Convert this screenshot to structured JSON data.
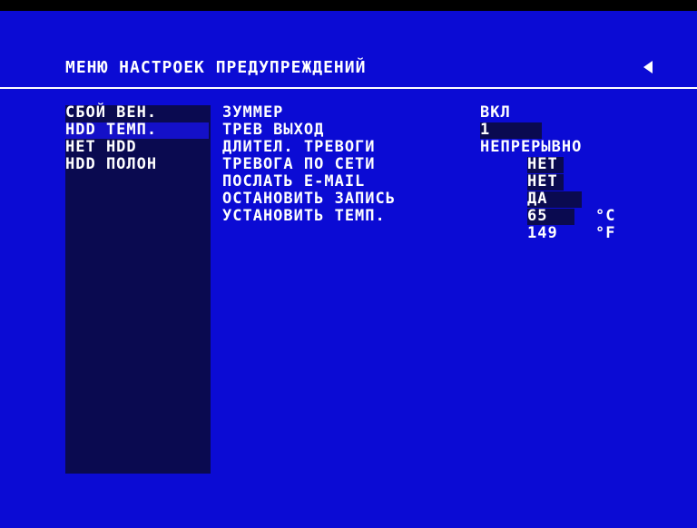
{
  "menu": {
    "title": "МЕНЮ НАСТРОЕК ПРЕДУПРЕЖДЕНИЙ",
    "back_icon": "left-triangle-arrow"
  },
  "sidebar": {
    "items": [
      {
        "label": "СБОЙ ВЕН.",
        "selected": false
      },
      {
        "label": "HDD ТЕМП.",
        "selected": true
      },
      {
        "label": "НЕТ HDD",
        "selected": false
      },
      {
        "label": "HDD ПОЛОН",
        "selected": false
      }
    ]
  },
  "settings": [
    {
      "label": "ЗУММЕР",
      "value": "ВКЛ"
    },
    {
      "label": "ТРЕВ ВЫХОД",
      "value": "1"
    },
    {
      "label": "ДЛИТЕЛ. ТРЕВОГИ",
      "value": "НЕПРЕРЫВНО"
    },
    {
      "label": "ТРЕВОГА ПО СЕТИ",
      "value": "НЕТ"
    },
    {
      "label": "ПОСЛАТЬ E-MAIL",
      "value": "НЕТ"
    },
    {
      "label": "ОСТАНОВИТЬ ЗАПИСЬ",
      "value": "ДА"
    },
    {
      "label": "УСТАНОВИТЬ ТЕМП.",
      "value": "65",
      "unit": "°C"
    }
  ],
  "temp_fahrenheit": {
    "value": "149",
    "unit": "°F"
  },
  "colors": {
    "background": "#0b0bd4",
    "sidebar": "#0a0a50",
    "selected": "#1410c8",
    "text": "#ffffff"
  }
}
